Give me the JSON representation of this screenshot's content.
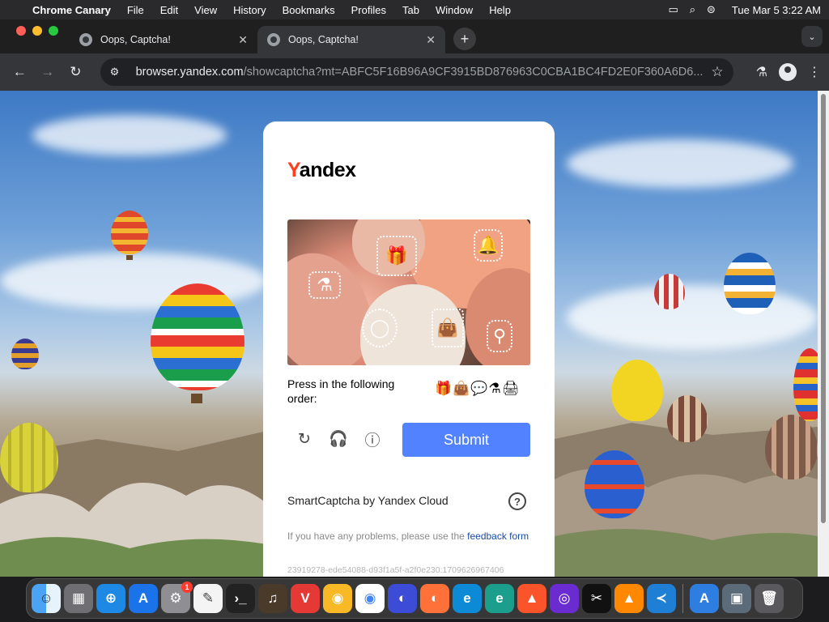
{
  "menubar": {
    "app": "Chrome Canary",
    "items": [
      "File",
      "Edit",
      "View",
      "History",
      "Bookmarks",
      "Profiles",
      "Tab",
      "Window",
      "Help"
    ],
    "clock": "Tue Mar 5  3:22 AM"
  },
  "tabs": [
    {
      "title": "Oops, Captcha!",
      "active": false
    },
    {
      "title": "Oops, Captcha!",
      "active": true
    }
  ],
  "toolbar": {
    "url_host": "browser.yandex.com",
    "url_path": "/showcaptcha?mt=ABFC5F16B96A9CF3915BD876963C0CBA1BC4FD2E0F360A6D6..."
  },
  "captcha": {
    "logo_first": "Y",
    "logo_rest": "andex",
    "instruction": "Press in the following order:",
    "order_icons": "🎁👜💬⚗🖨",
    "submit_label": "Submit",
    "provider": "SmartCaptcha by Yandex Cloud",
    "help_symbol": "?",
    "problems_text": "If you have any problems, please use the ",
    "problems_link": "feedback form",
    "request_id": "23919278-ede54088-d93f1a5f-a2f0e230:1709626967406"
  },
  "dock": {
    "notification_badge": "1"
  },
  "colors": {
    "accent": "#5282ff",
    "logo_red": "#fc3f1d",
    "chrome_dark": "#35363a"
  }
}
